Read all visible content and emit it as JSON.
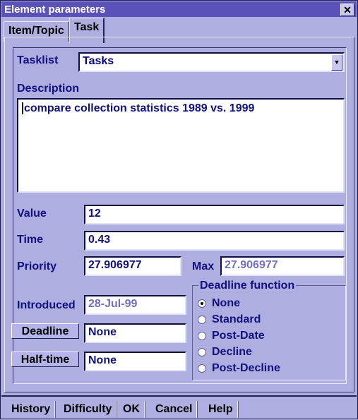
{
  "window": {
    "title": "Element parameters",
    "close_icon": "close-x"
  },
  "tabs": [
    {
      "label": "Item/Topic",
      "active": false
    },
    {
      "label": "Task",
      "active": true
    }
  ],
  "form": {
    "tasklist": {
      "label": "Tasklist",
      "value": "Tasks"
    },
    "description": {
      "label": "Description",
      "value": "compare collection statistics 1989 vs. 1999"
    },
    "value": {
      "label": "Value",
      "value": "12"
    },
    "time": {
      "label": "Time",
      "value": "0.43"
    },
    "priority": {
      "label": "Priority",
      "value": "27.906977"
    },
    "max": {
      "label": "Max",
      "value": "27.906977"
    },
    "introduced": {
      "label": "Introduced",
      "value": "28-Jul-99"
    },
    "deadline": {
      "button_label": "Deadline",
      "value": "None"
    },
    "halftime": {
      "button_label": "Half-time",
      "value": "None"
    }
  },
  "deadline_function": {
    "title": "Deadline function",
    "options": [
      "None",
      "Standard",
      "Post-Date",
      "Decline",
      "Post-Decline"
    ],
    "selected": "None"
  },
  "footer": {
    "buttons": [
      "History",
      "Difficulty",
      "OK",
      "Cancel",
      "Help"
    ]
  },
  "colors": {
    "titlebar": "#5a52b8",
    "background": "#aeaee0",
    "text_dark_blue": "#101080"
  }
}
